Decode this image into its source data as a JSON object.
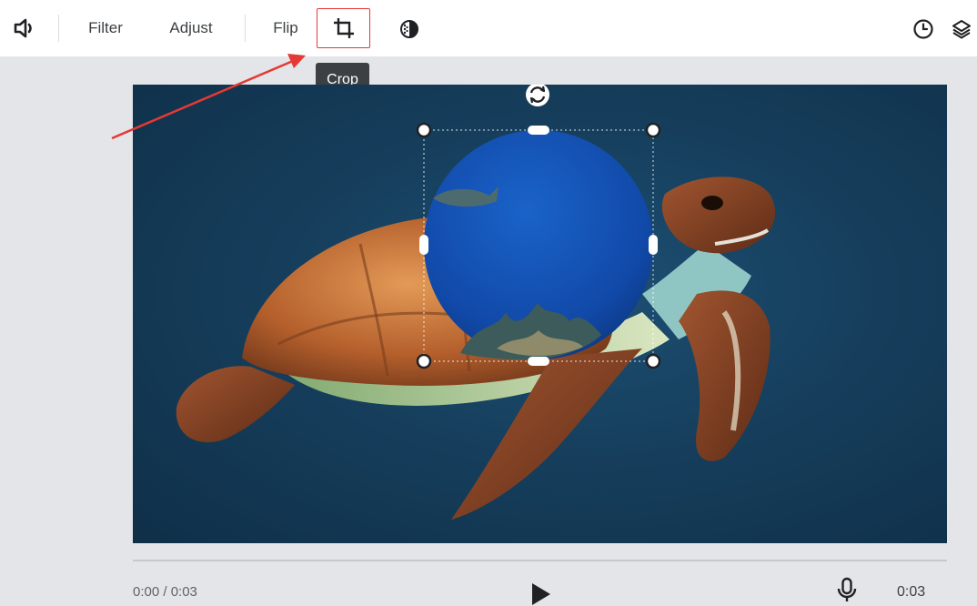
{
  "toolbar": {
    "volume_icon": "volume-icon",
    "filter_label": "Filter",
    "adjust_label": "Adjust",
    "flip_label": "Flip",
    "crop_icon": "crop-icon",
    "mask_icon": "mask-icon",
    "history_icon": "clock-icon",
    "layers_icon": "layers-icon"
  },
  "tooltip": {
    "text": "Crop"
  },
  "canvas": {
    "image_description_icon": "turtle-image",
    "overlay_shape": "circle",
    "rotate_icon": "rotate-icon"
  },
  "player": {
    "time_elapsed": "0:00 / 0:03",
    "duration": "0:03",
    "play_icon": "play-icon",
    "mic_icon": "microphone-icon"
  },
  "colors": {
    "accent_red": "#e53935",
    "tooltip_bg": "#3c4043",
    "canvas_bg": "#163f5d"
  }
}
